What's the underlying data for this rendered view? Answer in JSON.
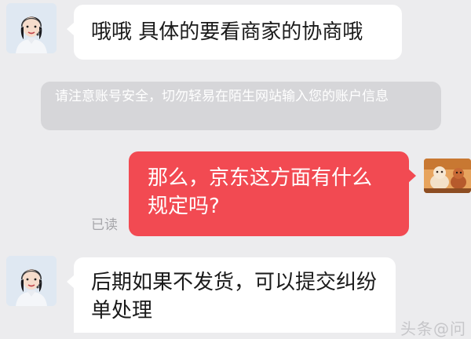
{
  "messages": [
    {
      "from": "merchant",
      "text": "哦哦 具体的要看商家的协商哦",
      "avatar_icon": "agent-avatar-icon"
    },
    {
      "from": "system",
      "text": "请注意账号安全，切勿轻易在陌生网站输入您的账户信息"
    },
    {
      "from": "me",
      "text": "那么，京东这方面有什么规定吗?",
      "status": "已读",
      "avatar_icon": "user-avatar-icon"
    },
    {
      "from": "merchant",
      "text": "后期如果不发货，可以提交纠纷单处理",
      "avatar_icon": "agent-avatar-icon"
    }
  ],
  "watermark": "头条@问",
  "colors": {
    "background": "#ececee",
    "incoming_bubble": "#ffffff",
    "outgoing_bubble": "#f24a52",
    "system_notice": "#d6d6d9"
  }
}
